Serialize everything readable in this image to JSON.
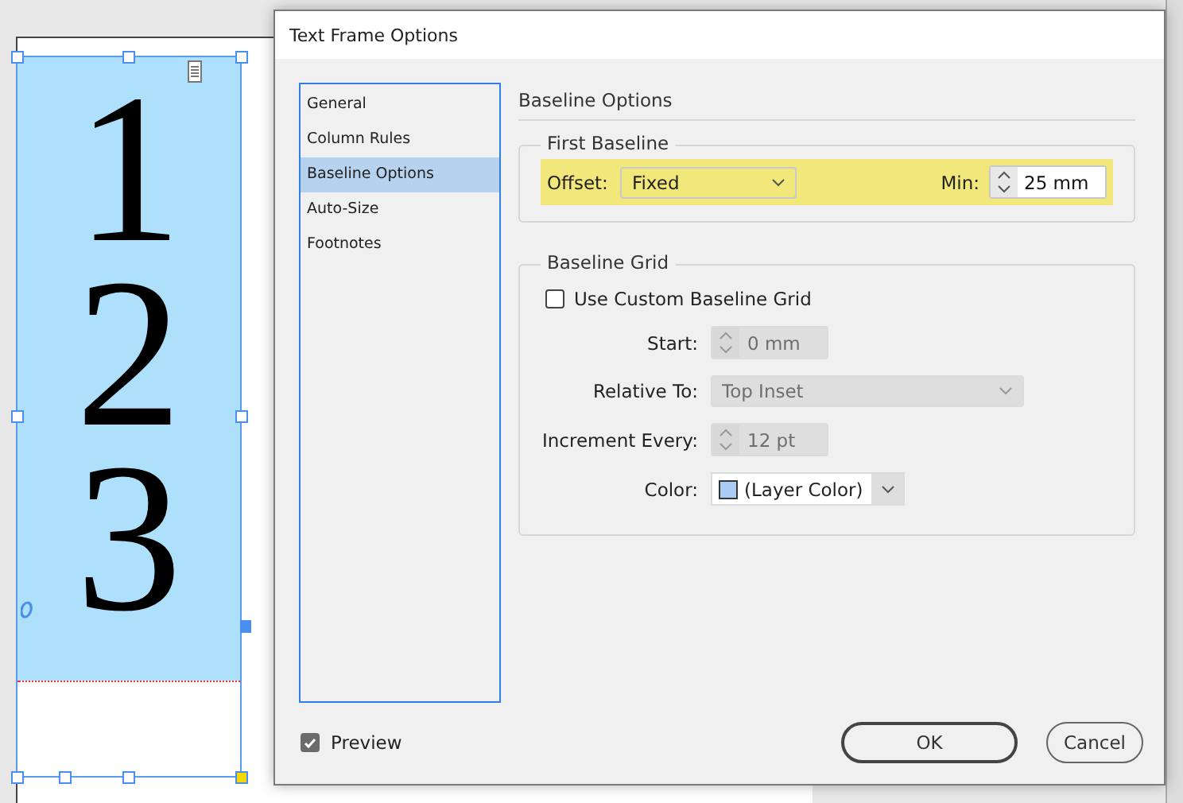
{
  "document": {
    "frame_text": [
      "1",
      "2",
      "3"
    ]
  },
  "dialog": {
    "title": "Text Frame Options",
    "categories": [
      {
        "label": "General",
        "selected": false
      },
      {
        "label": "Column Rules",
        "selected": false
      },
      {
        "label": "Baseline Options",
        "selected": true
      },
      {
        "label": "Auto-Size",
        "selected": false
      },
      {
        "label": "Footnotes",
        "selected": false
      }
    ],
    "section_title": "Baseline Options",
    "first_baseline": {
      "legend": "First Baseline",
      "offset_label": "Offset:",
      "offset_value": "Fixed",
      "min_label": "Min:",
      "min_value": "25 mm",
      "highlighted": true
    },
    "baseline_grid": {
      "legend": "Baseline Grid",
      "use_custom": {
        "label": "Use Custom Baseline Grid",
        "checked": false
      },
      "fields": [
        {
          "kind": "spinner",
          "label": "Start:",
          "value": "0 mm",
          "disabled": true
        },
        {
          "kind": "dropdown",
          "label": "Relative To:",
          "value": "Top Inset",
          "disabled": true
        },
        {
          "kind": "spinner",
          "label": "Increment Every:",
          "value": "12 pt",
          "disabled": true
        },
        {
          "kind": "color",
          "label": "Color:",
          "value": "(Layer Color)",
          "color": "#a9cbf4",
          "disabled": false
        }
      ]
    },
    "preview": {
      "label": "Preview",
      "checked": true
    },
    "buttons": [
      {
        "label": "OK",
        "default": true
      },
      {
        "label": "Cancel",
        "default": false
      }
    ]
  }
}
